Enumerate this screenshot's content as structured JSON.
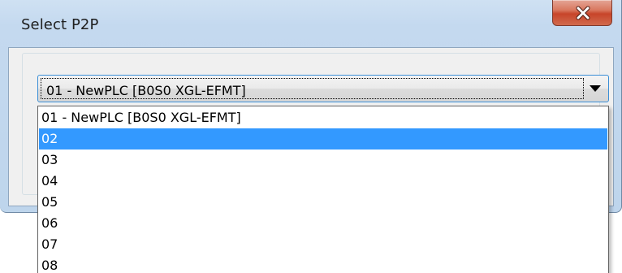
{
  "window": {
    "title": "Select P2P",
    "close_glyph": "close-icon"
  },
  "combo": {
    "selected_value": "01 - NewPLC [B0S0 XGL-EFMT]",
    "arrow_icon": "chevron-down-icon"
  },
  "dropdown": {
    "items": [
      {
        "label": "01 - NewPLC [B0S0 XGL-EFMT]",
        "selected": false
      },
      {
        "label": "02",
        "selected": true
      },
      {
        "label": "03",
        "selected": false
      },
      {
        "label": "04",
        "selected": false
      },
      {
        "label": "05",
        "selected": false
      },
      {
        "label": "06",
        "selected": false
      },
      {
        "label": "07",
        "selected": false
      },
      {
        "label": "08",
        "selected": false
      }
    ]
  },
  "colors": {
    "selection_highlight": "#3399ff",
    "focus_border": "#3a8ed6",
    "close_button": "#c7452a"
  }
}
